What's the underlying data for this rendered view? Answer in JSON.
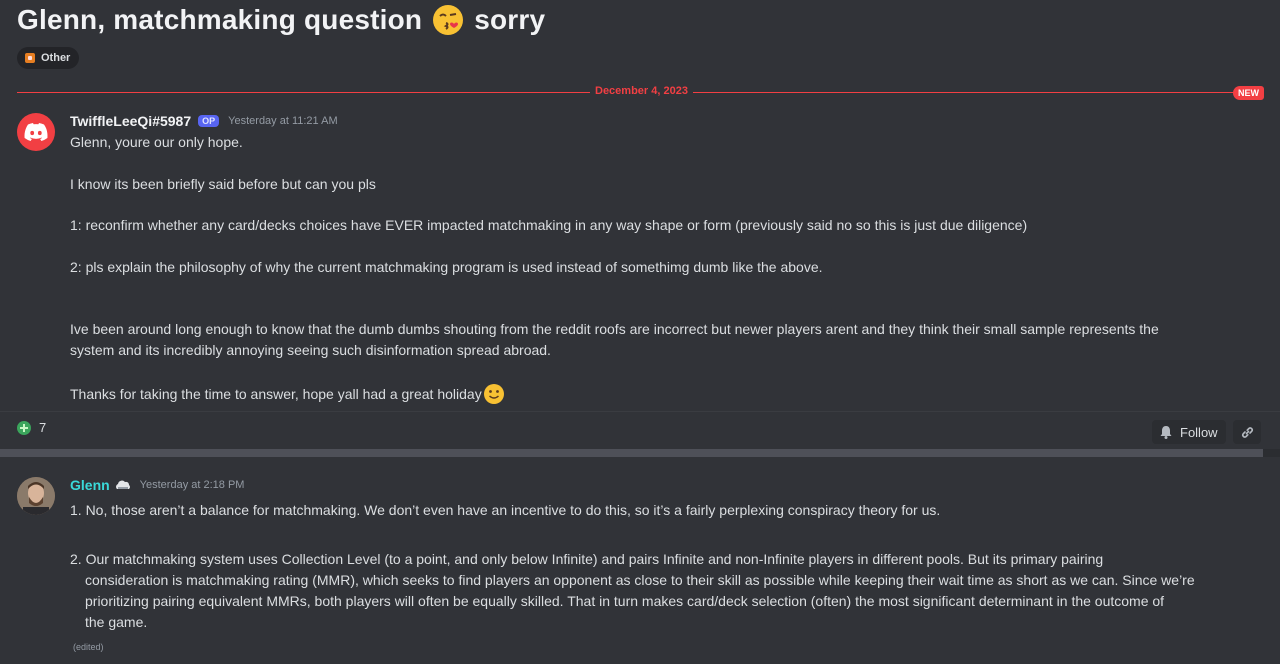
{
  "thread": {
    "title": "Glenn, matchmaking question",
    "title_suffix": "sorry",
    "tag": "Other"
  },
  "divider": {
    "date": "December 4, 2023",
    "new_badge": "NEW"
  },
  "post": {
    "username": "TwiffleLeeQi#5987",
    "badge": "OP",
    "timestamp": "Yesterday at 11:21 AM",
    "lines": [
      "Glenn, youre our only hope.",
      "I know its been briefly said before but can you pls",
      "1: reconfirm whether any card/decks choices have EVER impacted matchmaking in any way shape or form (previously said no so this is just due diligence)",
      "2: pls explain the philosophy of why the current matchmaking program is used instead of somethimg dumb like the above.",
      "Ive been around long enough to know that the dumb dumbs shouting from the reddit roofs are incorrect but newer players arent and they think their small sample represents the",
      "system and its incredibly annoying seeing such disinformation spread abroad.",
      "Thanks for taking the time to answer, hope yall had a great holiday"
    ],
    "reaction_count": "7",
    "follow_label": "Follow"
  },
  "reply": {
    "username": "Glenn",
    "timestamp": "Yesterday at 2:18 PM",
    "item1": "1. No, those aren’t a balance for matchmaking. We don’t even have an incentive to do this, so it’s a fairly perplexing conspiracy theory for us.",
    "item2_lines": [
      "2. Our matchmaking system uses Collection Level (to a point, and only below Infinite) and pairs Infinite and non-Infinite players in different pools. But its primary pairing",
      "consideration is matchmaking rating (MMR), which seeks to find players an opponent as close to their skill as possible while keeping their wait time as short as we can. Since we’re",
      "prioritizing pairing equivalent MMRs, both players will often be equally skilled. That  in turn makes card/deck selection (often) the most significant determinant in the outcome of",
      "the game."
    ],
    "edited": "(edited)"
  },
  "colors": {
    "background": "#313338",
    "accent_red": "#f23f43",
    "glenn_name": "#3ad9d9",
    "op_badge": "#5865f2"
  }
}
